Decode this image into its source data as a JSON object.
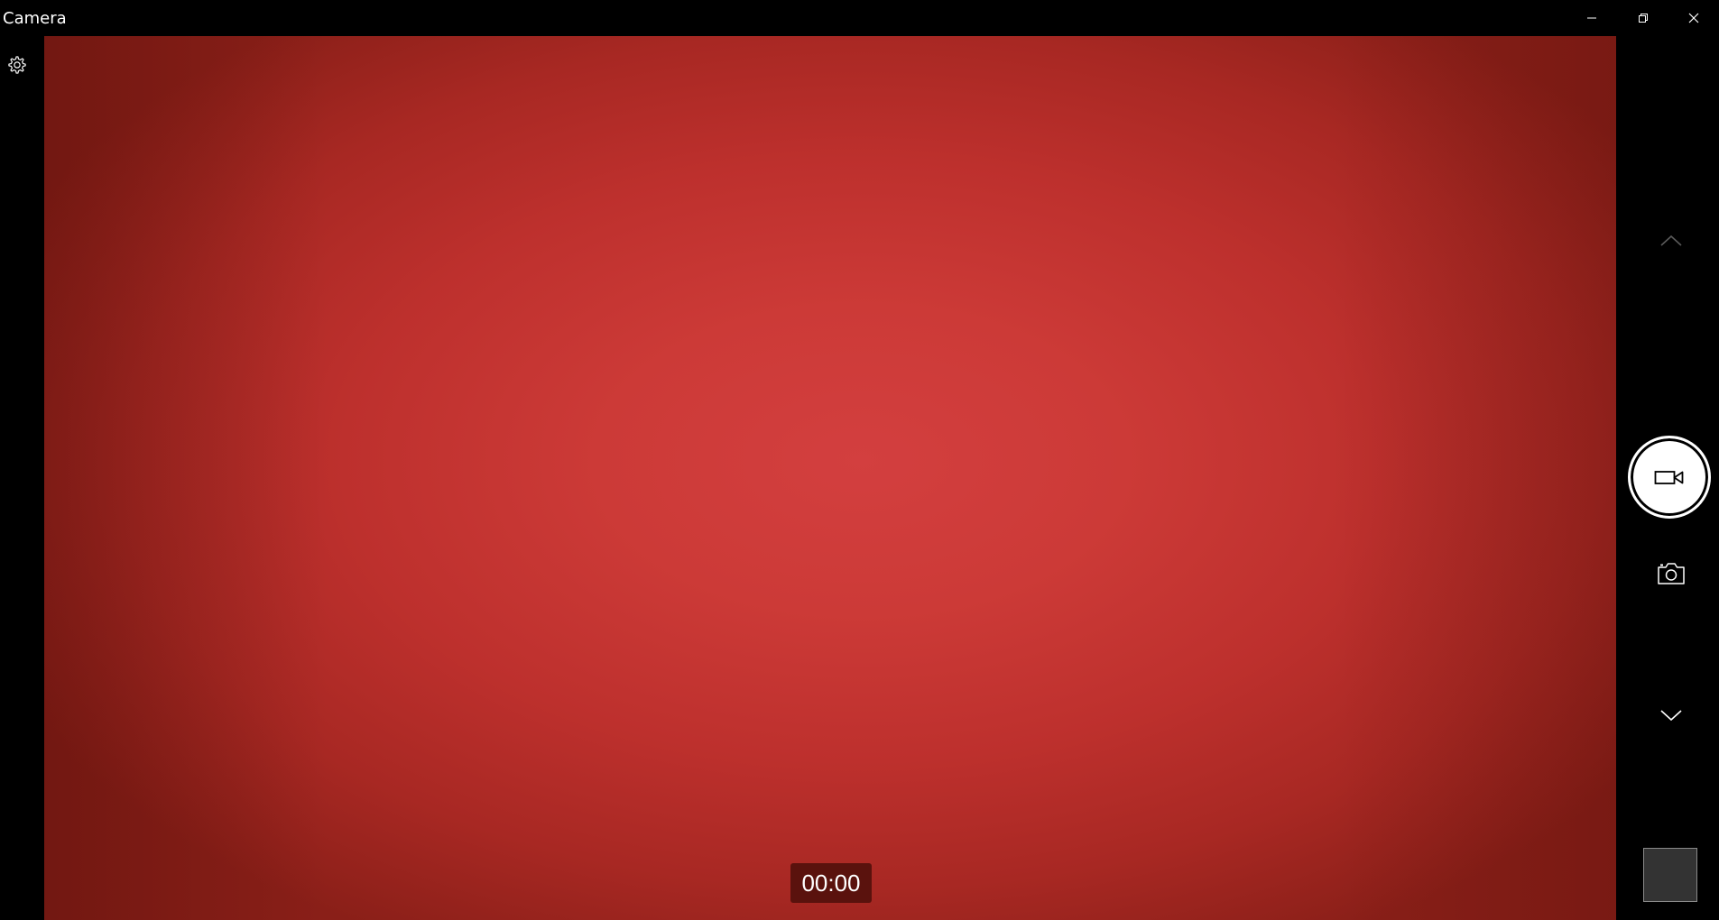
{
  "app": {
    "title": "Camera"
  },
  "window_controls": {
    "minimize_icon": "minimize-icon",
    "restore_icon": "restore-icon",
    "close_icon": "close-icon"
  },
  "toolbar": {
    "settings_icon": "gear-icon"
  },
  "viewfinder": {
    "timer": "00:00",
    "colors": {
      "center": "#d33f3f",
      "edge": "#8a1f18"
    }
  },
  "controls": {
    "scroll_up_icon": "chevron-up-icon",
    "record_icon": "video-camera-icon",
    "photo_icon": "camera-icon",
    "scroll_down_icon": "chevron-down-icon",
    "thumbnail_icon": "last-capture-thumbnail"
  },
  "colors": {
    "background": "#000000",
    "shutter": "#ffffff",
    "thumbnail": "#333333"
  }
}
